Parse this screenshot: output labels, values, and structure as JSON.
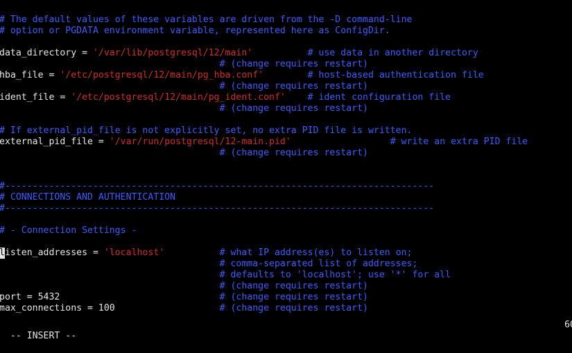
{
  "editor": {
    "lines": [
      {
        "segments": [
          {
            "text": "#------------------------------------------------------------------------------",
            "kind": "comment"
          }
        ]
      },
      {
        "segments": []
      },
      {
        "segments": [
          {
            "text": "# The default values of these variables are driven from the -D command-line",
            "kind": "comment"
          }
        ]
      },
      {
        "segments": [
          {
            "text": "# option or PGDATA environment variable, represented here as ConfigDir.",
            "kind": "comment"
          }
        ]
      },
      {
        "segments": []
      },
      {
        "segments": [
          {
            "text": "data_directory = ",
            "kind": "plain"
          },
          {
            "text": "'/var/lib/postgresql/12/main'",
            "kind": "string"
          },
          {
            "text": "          ",
            "kind": "plain"
          },
          {
            "text": "# use data in another directory",
            "kind": "comment"
          }
        ]
      },
      {
        "segments": [
          {
            "text": "                                        ",
            "kind": "plain"
          },
          {
            "text": "# (change requires restart)",
            "kind": "comment"
          }
        ]
      },
      {
        "segments": [
          {
            "text": "hba_file = ",
            "kind": "plain"
          },
          {
            "text": "'/etc/postgresql/12/main/pg_hba.conf'",
            "kind": "string"
          },
          {
            "text": "        ",
            "kind": "plain"
          },
          {
            "text": "# host-based authentication file",
            "kind": "comment"
          }
        ]
      },
      {
        "segments": [
          {
            "text": "                                        ",
            "kind": "plain"
          },
          {
            "text": "# (change requires restart)",
            "kind": "comment"
          }
        ]
      },
      {
        "segments": [
          {
            "text": "ident_file = ",
            "kind": "plain"
          },
          {
            "text": "'/etc/postgresql/12/main/pg_ident.conf'",
            "kind": "string"
          },
          {
            "text": "    ",
            "kind": "plain"
          },
          {
            "text": "# ident configuration file",
            "kind": "comment"
          }
        ]
      },
      {
        "segments": [
          {
            "text": "                                        ",
            "kind": "plain"
          },
          {
            "text": "# (change requires restart)",
            "kind": "comment"
          }
        ]
      },
      {
        "segments": []
      },
      {
        "segments": [
          {
            "text": "# If external_pid_file is not explicitly set, no extra PID file is written.",
            "kind": "comment"
          }
        ]
      },
      {
        "segments": [
          {
            "text": "external_pid_file = ",
            "kind": "plain"
          },
          {
            "text": "'/var/run/postgresql/12-main.pid'",
            "kind": "string"
          },
          {
            "text": "                  ",
            "kind": "plain"
          },
          {
            "text": "# write an extra PID file",
            "kind": "comment"
          }
        ]
      },
      {
        "segments": [
          {
            "text": "                                        ",
            "kind": "plain"
          },
          {
            "text": "# (change requires restart)",
            "kind": "comment"
          }
        ]
      },
      {
        "segments": []
      },
      {
        "segments": []
      },
      {
        "segments": [
          {
            "text": "#------------------------------------------------------------------------------",
            "kind": "comment"
          }
        ]
      },
      {
        "segments": [
          {
            "text": "# CONNECTIONS AND AUTHENTICATION",
            "kind": "comment"
          }
        ]
      },
      {
        "segments": [
          {
            "text": "#------------------------------------------------------------------------------",
            "kind": "comment"
          }
        ]
      },
      {
        "segments": []
      },
      {
        "segments": [
          {
            "text": "# - Connection Settings -",
            "kind": "comment"
          }
        ]
      },
      {
        "segments": []
      },
      {
        "segments": [
          {
            "text": "l",
            "kind": "cursor"
          },
          {
            "text": "isten_addresses = ",
            "kind": "plain"
          },
          {
            "text": "'localhost'",
            "kind": "string"
          },
          {
            "text": "          ",
            "kind": "plain"
          },
          {
            "text": "# what IP address(es) to listen on;",
            "kind": "comment"
          }
        ]
      },
      {
        "segments": [
          {
            "text": "                                        ",
            "kind": "plain"
          },
          {
            "text": "# comma-separated list of addresses;",
            "kind": "comment"
          }
        ]
      },
      {
        "segments": [
          {
            "text": "                                        ",
            "kind": "plain"
          },
          {
            "text": "# defaults to 'localhost'; use '*' for all",
            "kind": "comment"
          }
        ]
      },
      {
        "segments": [
          {
            "text": "                                        ",
            "kind": "plain"
          },
          {
            "text": "# (change requires restart)",
            "kind": "comment"
          }
        ]
      },
      {
        "segments": [
          {
            "text": "port = 5432",
            "kind": "plain"
          },
          {
            "text": "                             ",
            "kind": "plain"
          },
          {
            "text": "# (change requires restart)",
            "kind": "comment"
          }
        ]
      },
      {
        "segments": [
          {
            "text": "max_connections = 100",
            "kind": "plain"
          },
          {
            "text": "                   ",
            "kind": "plain"
          },
          {
            "text": "# (change requires restart)",
            "kind": "comment"
          }
        ]
      }
    ]
  },
  "statusbar": {
    "mode": "-- INSERT --",
    "position": "60"
  }
}
